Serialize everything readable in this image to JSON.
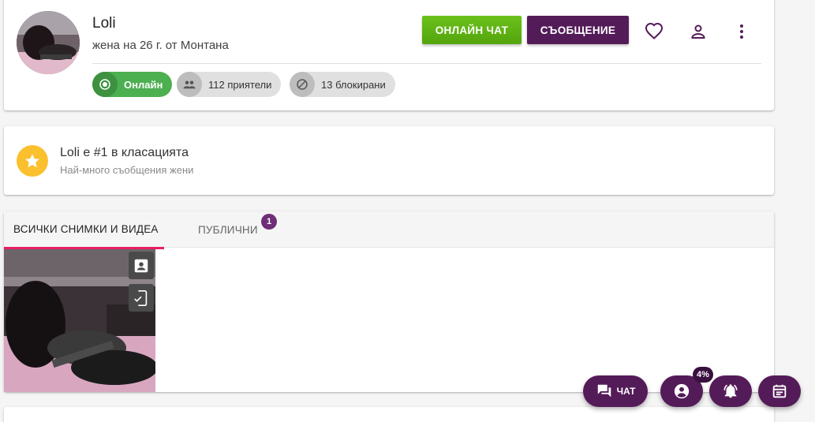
{
  "profile": {
    "name": "Loli",
    "subtitle": "жена на 26 г. от Монтана",
    "online_chat_label": "ОНЛАЙН ЧАТ",
    "message_label": "СЪОБЩЕНИЕ",
    "chips": {
      "online": "Онлайн",
      "friends": "112 приятели",
      "blocked": "13 блокирани"
    },
    "actions": [
      "heart-icon",
      "person-icon",
      "more-vert-icon"
    ]
  },
  "ranking": {
    "title": "Loli е #1 в класацията",
    "subtitle": "Най-много съобщения жени"
  },
  "gallery": {
    "tabs": {
      "all": "ВСИЧКИ СНИМКИ И ВИДЕА",
      "public": "ПУБЛИЧНИ",
      "public_badge": "1"
    },
    "thumbnail_actions": [
      "contact-card-icon",
      "mobile-check-icon"
    ]
  },
  "fabs": {
    "chat_label": "ЧАТ",
    "account_percent": "4%"
  },
  "colors": {
    "green": "#5cb514",
    "purple": "#541b59",
    "online": "#4caf50",
    "star": "#fbc02d",
    "tab_indicator": "#e91e63"
  }
}
